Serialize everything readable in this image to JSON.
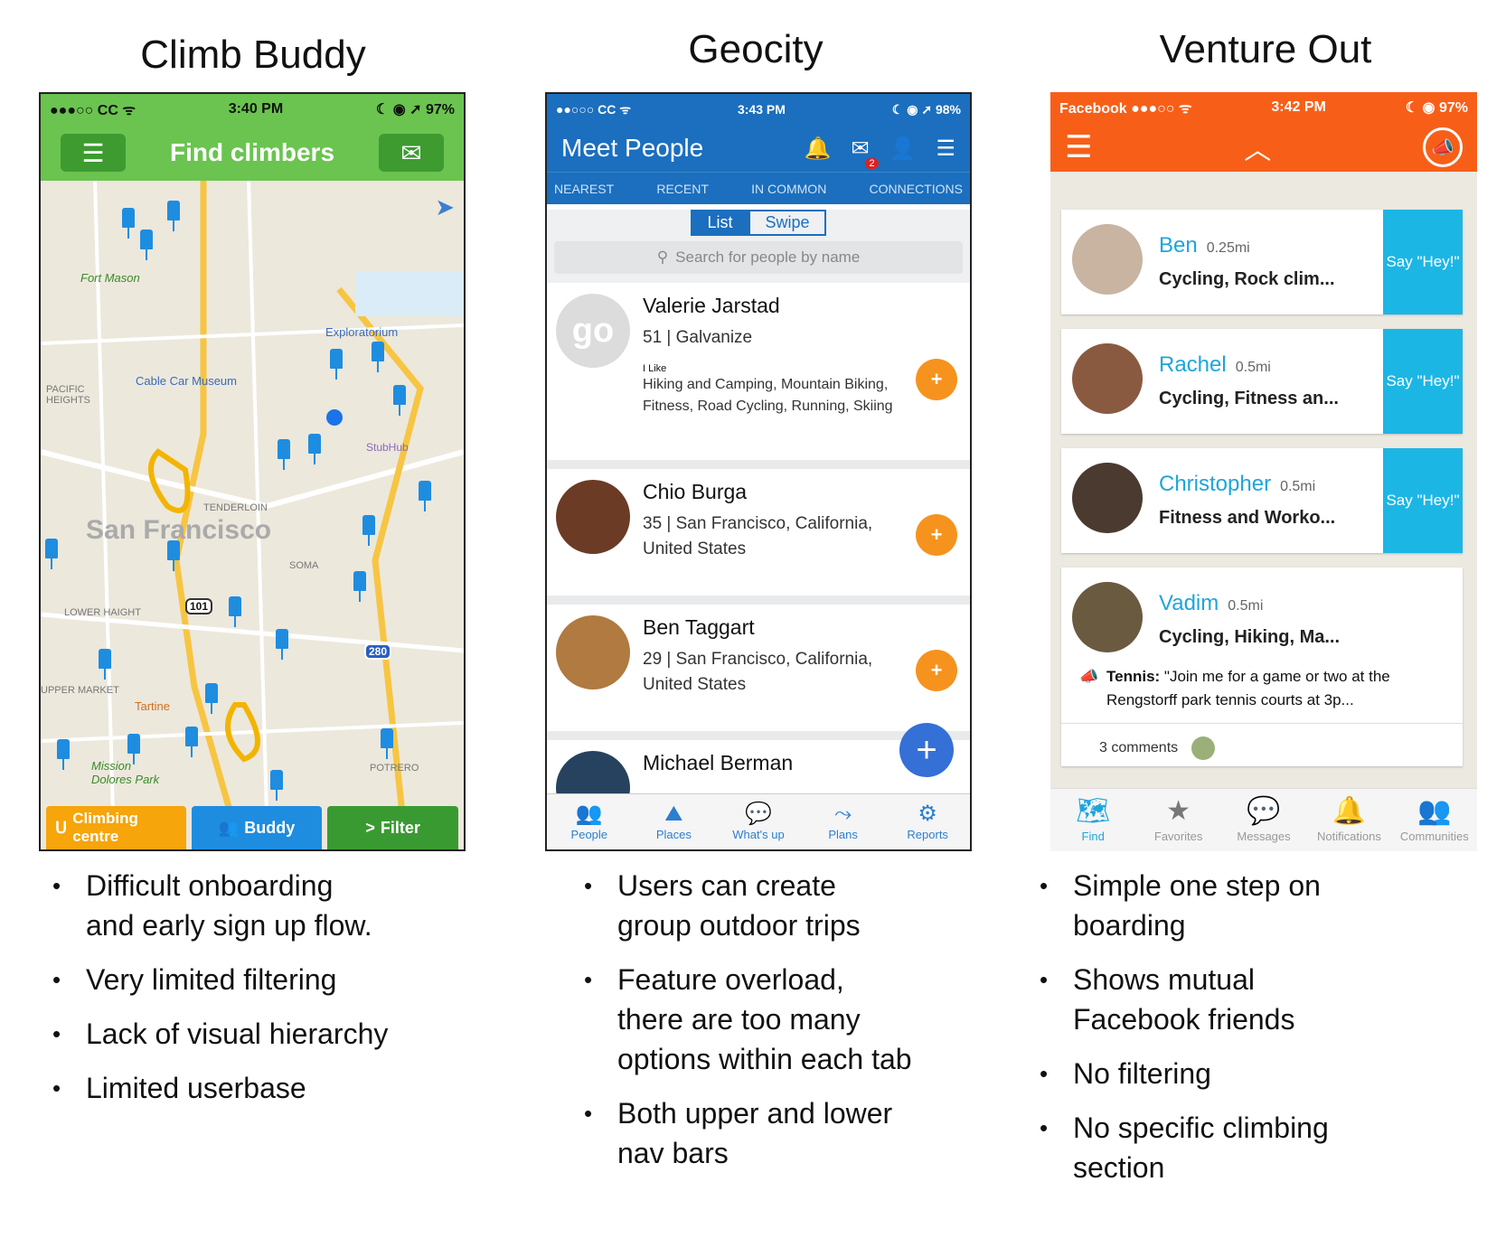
{
  "titles": {
    "climb": "Climb Buddy",
    "geocity": "Geocity",
    "venture": "Venture Out"
  },
  "climb": {
    "status": {
      "carrier": "●●●○○ CC ᯤ",
      "time": "3:40 PM",
      "battery": "☾ ◉ ➚ 97%"
    },
    "nav_title": "Find climbers",
    "map_labels": {
      "city": "San Francisco",
      "fort_mason": "Fort Mason",
      "cable_car": "Cable Car Museum",
      "exploratorium": "Exploratorium",
      "tenderloin": "TENDERLOIN",
      "pacific": "PACIFIC HEIGHTS",
      "mission_dolores": "Mission Dolores Park",
      "tartine": "Tartine",
      "potrero": "POTRERO",
      "upper_market": "UPPER MARKET",
      "lower_haight": "LOWER HAIGHT",
      "soma": "SOMA",
      "stubhub": "StubHub",
      "hw101": "101",
      "hw280": "280"
    },
    "bottom": [
      {
        "label": "Climbing centre",
        "color": "#f6a50b"
      },
      {
        "label": "Buddy",
        "color": "#1e8de0"
      },
      {
        "label": "Filter",
        "color": "#3a9a32"
      }
    ]
  },
  "geocity": {
    "status": {
      "carrier": "●●○○○ CC ᯤ",
      "time": "3:43 PM",
      "battery": "☾ ◉ ➚ 98%"
    },
    "nav_title": "Meet People",
    "badge": "2",
    "tabs": [
      "NEAREST",
      "RECENT",
      "IN COMMON",
      "CONNECTIONS"
    ],
    "segment": [
      "List",
      "Swipe"
    ],
    "search_placeholder": "Search for people by name",
    "people": [
      {
        "name": "Valerie Jarstad",
        "line1": "51 | Galvanize",
        "like_label": "I Like",
        "likes": "Hiking and Camping, Mountain Biking, Fitness, Road Cycling, Running, Skiing",
        "avatar_text": "go"
      },
      {
        "name": "Chio Burga",
        "line1": "35 | San Francisco, California,",
        "line2": "United States"
      },
      {
        "name": "Ben Taggart",
        "line1": "29 | San Francisco, California,",
        "line2": "United States"
      },
      {
        "name": "Michael Berman"
      }
    ],
    "bottom_nav": [
      "People",
      "Places",
      "What's up",
      "Plans",
      "Reports"
    ]
  },
  "venture": {
    "status": {
      "carrier": "Facebook ●●●○○ ᯤ",
      "time": "3:42 PM",
      "battery": "☾ ◉ 97%"
    },
    "people": [
      {
        "name": "Ben",
        "dist": "0.25mi",
        "interests": "Cycling, Rock clim...",
        "cta": "Say \"Hey!\""
      },
      {
        "name": "Rachel",
        "dist": "0.5mi",
        "interests": "Cycling, Fitness an...",
        "cta": "Say \"Hey!\""
      },
      {
        "name": "Christopher",
        "dist": "0.5mi",
        "interests": "Fitness and Worko...",
        "cta": "Say \"Hey!\""
      },
      {
        "name": "Vadim",
        "dist": "0.5mi",
        "interests": "Cycling, Hiking, Ma...",
        "post_label": "Tennis:",
        "post": " \"Join me for a game or two at the Rengstorff park tennis courts at 3p...",
        "comments": "3 comments"
      }
    ],
    "bottom_nav": [
      "Find",
      "Favorites",
      "Messages",
      "Notifications",
      "Communities"
    ]
  },
  "bullets": {
    "climb": [
      "Difficult onboarding|and early sign up flow.",
      "Very limited filtering",
      "Lack of visual hierarchy",
      "Limited userbase"
    ],
    "geocity": [
      "Users can create|group outdoor trips",
      "Feature overload,|there are too many|options within each tab",
      "Both upper and lower|nav bars"
    ],
    "venture": [
      "Simple one step on|boarding",
      "Shows mutual|Facebook friends",
      "No filtering",
      "No specific climbing|section"
    ]
  }
}
